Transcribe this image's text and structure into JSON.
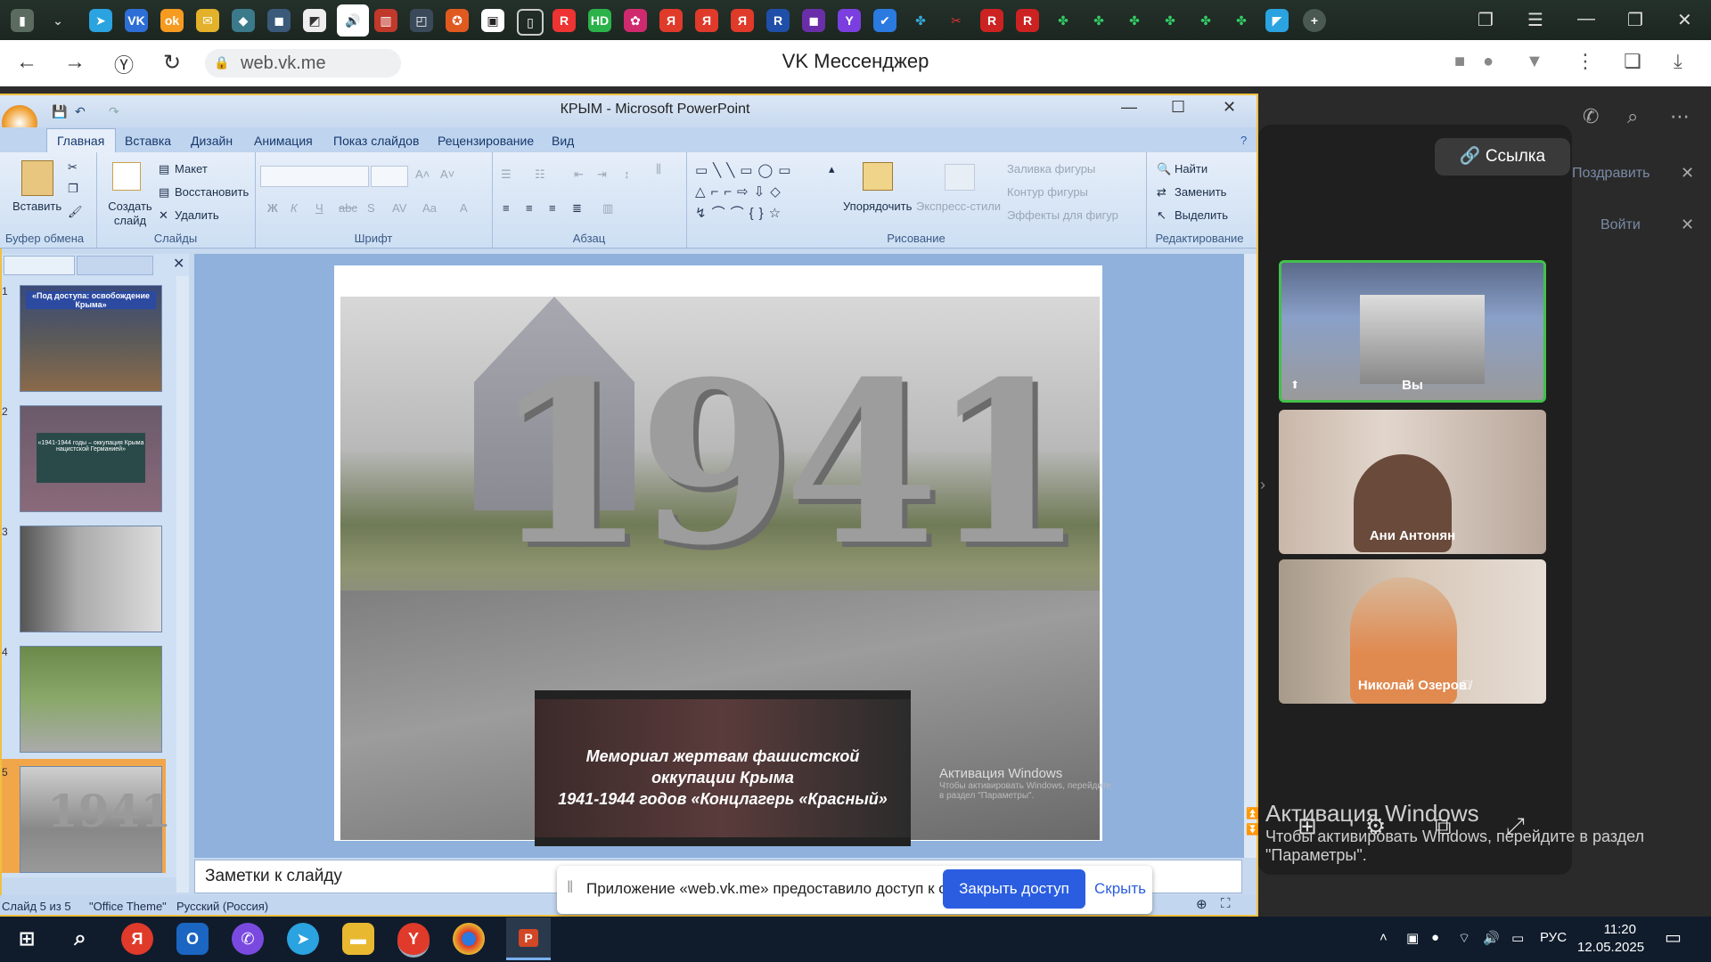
{
  "browser": {
    "url": "web.vk.me",
    "page_title": "VK Мессенджер"
  },
  "colors": {
    "accent_blue": "#2a5de0",
    "ppt_blue": "#c7d9ef",
    "vk_dark": "#1f1f1f",
    "active_tile_border": "#43c04b"
  },
  "ppt": {
    "window_title": "КРЫМ - Microsoft PowerPoint",
    "tabs": [
      "Главная",
      "Вставка",
      "Дизайн",
      "Анимация",
      "Показ слайдов",
      "Рецензирование",
      "Вид"
    ],
    "ribbon": {
      "paste": "Вставить",
      "clipboard_group": "Буфер обмена",
      "create_slide": "Создать слайд",
      "layout": "Макет",
      "restore": "Восстановить",
      "delete": "Удалить",
      "slides_group": "Слайды",
      "font_group": "Шрифт",
      "paragraph_group": "Абзац",
      "arrange": "Упорядочить",
      "express_styles": "Экспресс-стили",
      "shape_fill": "Заливка фигуры",
      "shape_outline": "Контур фигуры",
      "shape_effects": "Эффекты для фигур",
      "drawing_group": "Рисование",
      "find": "Найти",
      "replace": "Заменить",
      "select": "Выделить",
      "editing_group": "Редактирование"
    },
    "slide_numbers": [
      "1",
      "2",
      "3",
      "4",
      "5"
    ],
    "thumb1_text": "«Под доступа: освобождение Крыма»",
    "thumb2_text": "«1941-1944 годы – оккупация Крыма нацистской Германией»",
    "slide": {
      "big_number": "1941",
      "caption_line1": "Мемориал жертвам фашистской оккупации Крыма",
      "caption_line2": "1941-1944 годов «Концлагерь «Красный»",
      "activation_title": "Активация Windows",
      "activation_sub": "Чтобы активировать Windows, перейдите в раздел \"Параметры\"."
    },
    "notes_placeholder": "Заметки к слайду",
    "status": {
      "slide_of": "Слайд 5 из 5",
      "theme": "\"Office Theme\"",
      "language": "Русский (Россия)"
    }
  },
  "share_bar": {
    "text": "Приложение «web.vk.me» предоставило доступ к окну.",
    "close_access": "Закрыть доступ",
    "hide": "Скрыть"
  },
  "vk": {
    "link_button": "Ссылка",
    "congratulate": "Поздравить",
    "login": "Войти",
    "participants": [
      {
        "name": "Вы"
      },
      {
        "name": "Ани Антонян"
      },
      {
        "name": "Николай Озеров"
      }
    ],
    "activation_title": "Активация Windows",
    "activation_sub": "Чтобы активировать Windows, перейдите в раздел \"Параметры\"."
  },
  "taskbar": {
    "time": "11:20",
    "date": "12.05.2025",
    "lang": "РУС"
  }
}
